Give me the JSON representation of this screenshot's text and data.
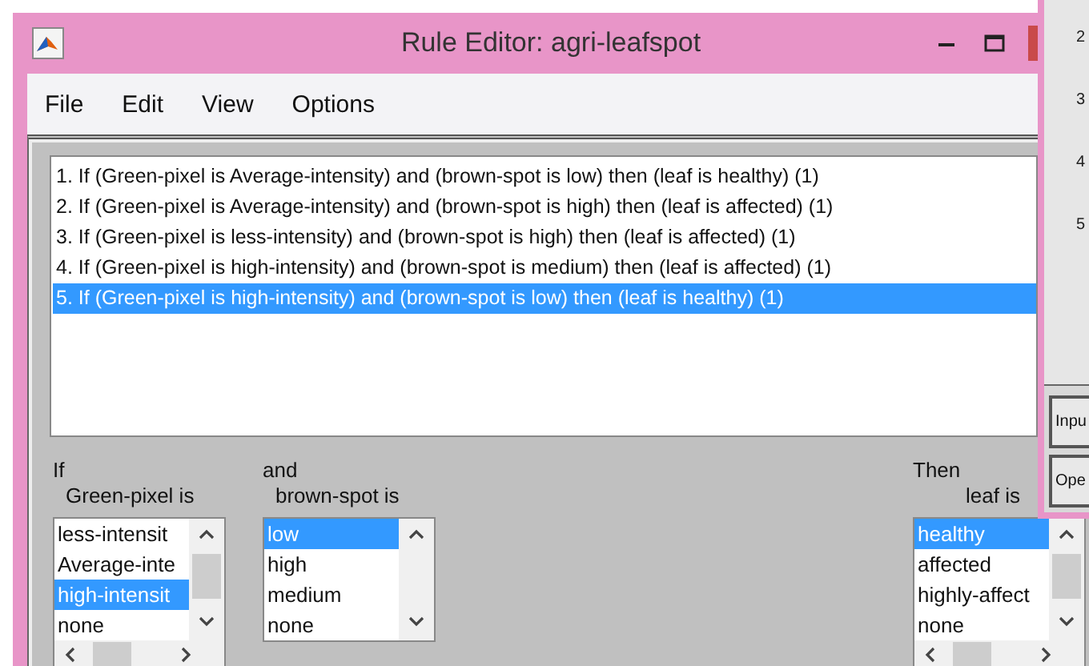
{
  "window": {
    "title": "Rule Editor: agri-leafspot"
  },
  "menu": [
    "File",
    "Edit",
    "View",
    "Options"
  ],
  "rules": [
    {
      "text": "1. If (Green-pixel is Average-intensity) and (brown-spot is low) then (leaf is healthy) (1)",
      "selected": false
    },
    {
      "text": "2. If (Green-pixel is Average-intensity) and (brown-spot is high) then (leaf is affected) (1)",
      "selected": false
    },
    {
      "text": "3. If (Green-pixel is less-intensity) and (brown-spot is high) then (leaf is affected) (1)",
      "selected": false
    },
    {
      "text": "4. If (Green-pixel is high-intensity) and (brown-spot is medium) then (leaf is affected) (1)",
      "selected": false
    },
    {
      "text": "5. If (Green-pixel is high-intensity) and (brown-spot is low) then (leaf is healthy) (1)",
      "selected": true
    }
  ],
  "variables": [
    {
      "connective": "If",
      "label": "Green-pixel is",
      "horizontal_scrollbar": true,
      "items": [
        {
          "text": "less-intensit",
          "selected": false
        },
        {
          "text": "Average-inte",
          "selected": false
        },
        {
          "text": "high-intensit",
          "selected": true
        },
        {
          "text": "none",
          "selected": false
        }
      ]
    },
    {
      "connective": "and",
      "label": "brown-spot is",
      "horizontal_scrollbar": false,
      "items": [
        {
          "text": "low",
          "selected": true
        },
        {
          "text": "high",
          "selected": false
        },
        {
          "text": "medium",
          "selected": false
        },
        {
          "text": "none",
          "selected": false
        }
      ]
    },
    {
      "connective": "Then",
      "label": "leaf is",
      "horizontal_scrollbar": true,
      "items": [
        {
          "text": "healthy",
          "selected": true
        },
        {
          "text": "affected",
          "selected": false
        },
        {
          "text": "highly-affect",
          "selected": false
        },
        {
          "text": "none",
          "selected": false
        }
      ]
    }
  ],
  "background_window": {
    "row_numbers": [
      "2",
      "3",
      "4",
      "5"
    ],
    "buttons": [
      "Inpu",
      "Ope"
    ]
  }
}
